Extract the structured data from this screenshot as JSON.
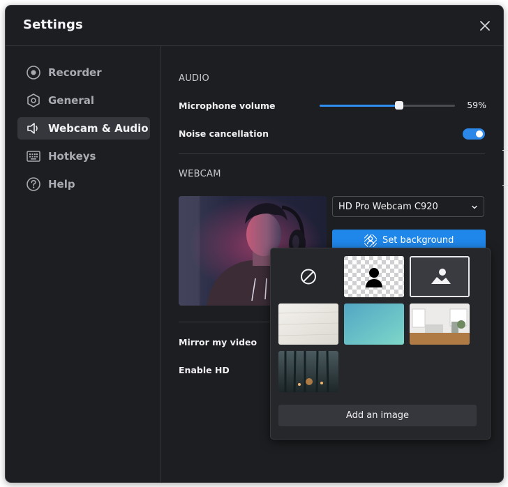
{
  "window": {
    "title": "Settings"
  },
  "sidebar": {
    "items": [
      {
        "label": "Recorder",
        "icon": "record-icon",
        "active": false
      },
      {
        "label": "General",
        "icon": "hexagon-settings-icon",
        "active": false
      },
      {
        "label": "Webcam & Audio",
        "icon": "speaker-icon",
        "active": true
      },
      {
        "label": "Hotkeys",
        "icon": "keyboard-icon",
        "active": false
      },
      {
        "label": "Help",
        "icon": "help-circle-icon",
        "active": false
      }
    ]
  },
  "audio": {
    "heading": "AUDIO",
    "microphone_label": "Microphone volume",
    "microphone_value": 59,
    "microphone_value_text": "59%",
    "noise_label": "Noise cancellation",
    "noise_enabled": true
  },
  "webcam": {
    "heading": "WEBCAM",
    "camera_selected": "HD Pro Webcam C920",
    "set_background_label": "Set background",
    "mirror_label": "Mirror my video",
    "hd_label": "Enable HD"
  },
  "background_picker": {
    "options": [
      {
        "name": "none",
        "icon": "no-background-icon"
      },
      {
        "name": "remove",
        "icon": "person-cutout-icon"
      },
      {
        "name": "blur",
        "icon": "blur-image-icon",
        "selected": true
      },
      {
        "name": "paper",
        "icon": "paper-texture-image"
      },
      {
        "name": "teal-gradient",
        "icon": "teal-gradient-image"
      },
      {
        "name": "living-room",
        "icon": "living-room-image"
      },
      {
        "name": "forest",
        "icon": "forest-image"
      }
    ],
    "add_image_label": "Add an image"
  },
  "colors": {
    "window_bg": "#1d1e21",
    "accent": "#1f86ea",
    "active_item_bg": "#36373c",
    "popup_bg": "#26272b"
  }
}
